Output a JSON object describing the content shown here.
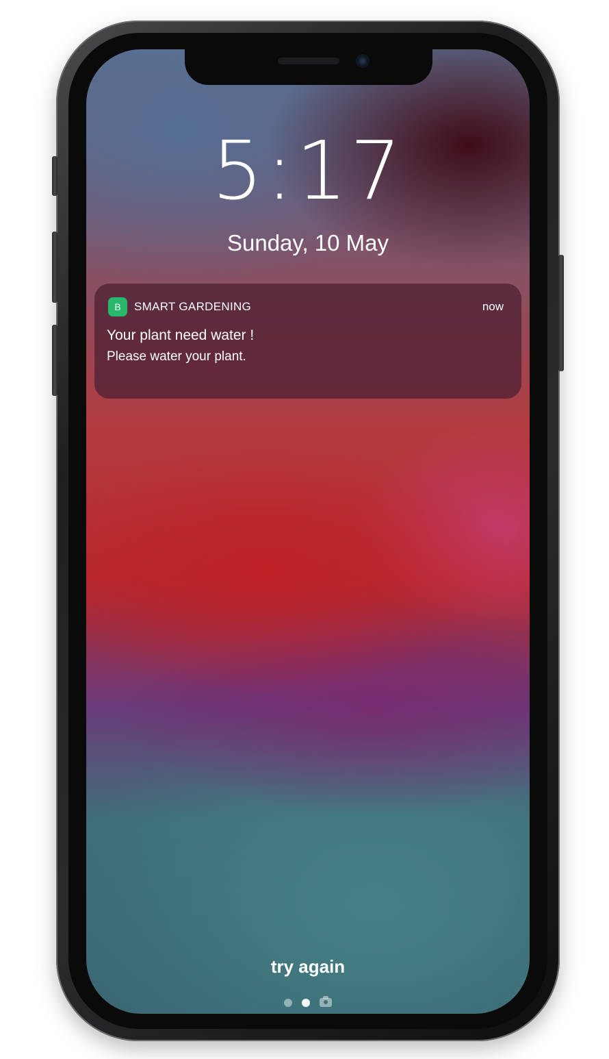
{
  "lock_screen": {
    "time": "5:17",
    "date": "Sunday, 10 May"
  },
  "notification": {
    "app_icon_letter": "B",
    "app_icon_color": "#29b86b",
    "app_name": "SMART GARDENING",
    "time": "now",
    "title": "Your plant need water !",
    "body": "Please water your plant."
  },
  "bottom": {
    "try_again": "try again",
    "page_indicator": {
      "pages": [
        "dot",
        "dot",
        "camera-icon"
      ],
      "active_index": 1
    }
  }
}
